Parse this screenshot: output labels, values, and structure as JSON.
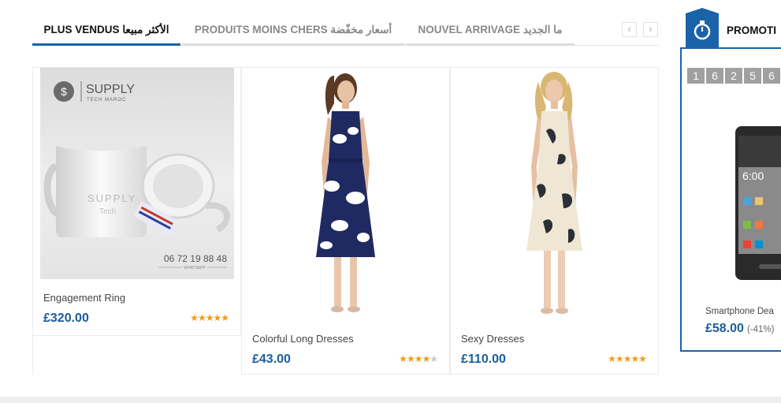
{
  "tabs": [
    {
      "label": "PLUS VENDUS الأكثر مبيعا",
      "active": true
    },
    {
      "label": "PRODUITS MOINS CHERS أسعار مخفّضة",
      "active": false
    },
    {
      "label": "NOUVEL ARRIVAGE ما الجديد",
      "active": false
    }
  ],
  "nav": {
    "prev": "‹",
    "next": "›"
  },
  "products": [
    {
      "name": "Engagement Ring",
      "price": "£320.00",
      "rating": 5,
      "image": {
        "brand": "SUPPLY",
        "brand_sub": "TECH MAROC",
        "phone": "06 72 19 88 48",
        "whatsapp": "WHATSAPP",
        "mug_text": "SUPPLY",
        "mug_text2": "Tech"
      }
    },
    {
      "name": "Colorful Long Dresses",
      "price": "£43.00",
      "rating": 4
    },
    {
      "name": "Sexy Dresses",
      "price": "£110.00",
      "rating": 5
    }
  ],
  "promo": {
    "title": "PROMOTI",
    "pager": [
      "1",
      "6",
      "2",
      "5",
      "6"
    ],
    "deal_name": "Smartphone Dea",
    "deal_price": "£58.00",
    "deal_discount": "(-41%)",
    "phone_time": "6:00"
  },
  "colors": {
    "accent": "#1b63a9",
    "price": "#1b5d9c",
    "star": "#f39c12"
  },
  "icons": {
    "promo_badge": "stopwatch-icon",
    "nav_prev": "chevron-left-icon",
    "nav_next": "chevron-right-icon"
  }
}
